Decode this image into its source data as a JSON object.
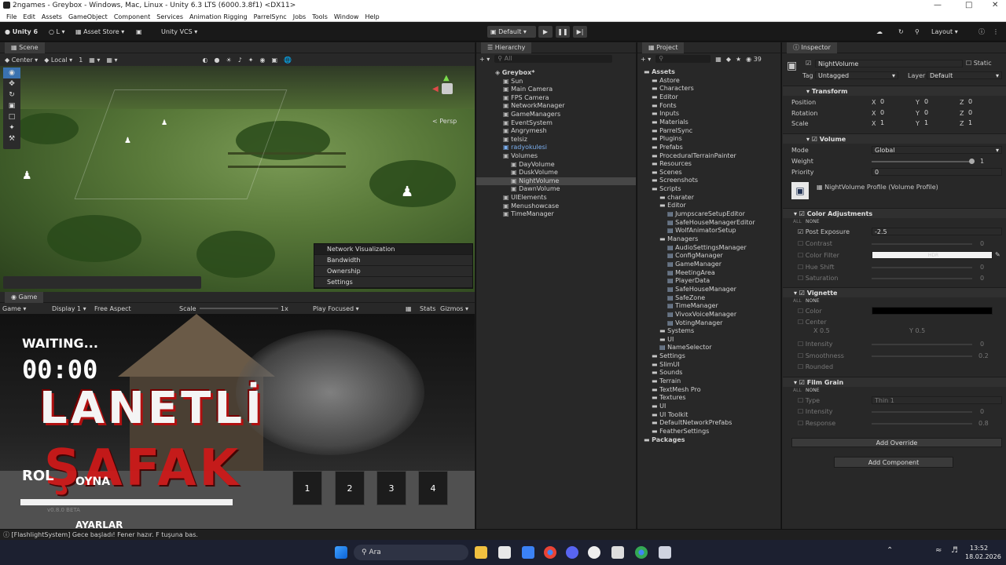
{
  "window": {
    "title": "2ngames - Greybox - Windows, Mac, Linux - Unity 6.3 LTS (6000.3.8f1) <DX11>"
  },
  "menu": [
    "File",
    "Edit",
    "Assets",
    "GameObject",
    "Component",
    "Services",
    "Animation Rigging",
    "ParrelSync",
    "Jobs",
    "Tools",
    "Window",
    "Help"
  ],
  "toolbar": {
    "account": "Unity 6",
    "user": "L",
    "asset_store": "Asset Store",
    "vcs": "Unity VCS",
    "play_mode": "Default",
    "layout": "Layout"
  },
  "scene": {
    "tab": "Scene",
    "pivot": "Center",
    "space": "Local",
    "grid": "1",
    "persp": "< Persp",
    "netvis": {
      "title": "Network Visualization",
      "items": [
        "Bandwidth",
        "Ownership",
        "Settings"
      ]
    }
  },
  "game": {
    "tab": "Game",
    "target": "Game",
    "display": "Display 1",
    "aspect": "Free Aspect",
    "scale_label": "Scale",
    "scale_value": "1x",
    "play_focused": "Play Focused",
    "stats": "Stats",
    "gizmos": "Gizmos",
    "waiting": "WAITING...",
    "timer": "00:00",
    "title1": "LANETLİ",
    "title2": "ŞAFAK",
    "menu_oyna": "OYNA",
    "menu_ayarlar": "AYARLAR",
    "menu_rol": "ROL",
    "slots": [
      "1",
      "2",
      "3",
      "4"
    ],
    "version": "v0.8.0 BETA"
  },
  "hierarchy": {
    "tab": "Hierarchy",
    "search": "All",
    "items": [
      {
        "label": "Greybox*",
        "depth": 0,
        "kind": "scene"
      },
      {
        "label": "Sun",
        "depth": 1
      },
      {
        "label": "Main Camera",
        "depth": 1
      },
      {
        "label": "FPS Camera",
        "depth": 1
      },
      {
        "label": "NetworkManager",
        "depth": 1
      },
      {
        "label": "GameManagers",
        "depth": 1
      },
      {
        "label": "EventSystem",
        "depth": 1
      },
      {
        "label": "Angrymesh",
        "depth": 1
      },
      {
        "label": "telsiz",
        "depth": 1
      },
      {
        "label": "radyokulesi",
        "depth": 1,
        "kind": "prefab"
      },
      {
        "label": "Volumes",
        "depth": 1
      },
      {
        "label": "DayVolume",
        "depth": 2
      },
      {
        "label": "DuskVolume",
        "depth": 2
      },
      {
        "label": "NightVolume",
        "depth": 2,
        "selected": true
      },
      {
        "label": "DawnVolume",
        "depth": 2
      },
      {
        "label": "UIElements",
        "depth": 1
      },
      {
        "label": "Menushowcase",
        "depth": 1
      },
      {
        "label": "TimeManager",
        "depth": 1
      }
    ]
  },
  "project": {
    "tab": "Project",
    "count": "39",
    "items": [
      {
        "label": "Assets",
        "depth": 0
      },
      {
        "label": "Astore",
        "depth": 1
      },
      {
        "label": "Characters",
        "depth": 1
      },
      {
        "label": "Editor",
        "depth": 1
      },
      {
        "label": "Fonts",
        "depth": 1
      },
      {
        "label": "Inputs",
        "depth": 1
      },
      {
        "label": "Materials",
        "depth": 1
      },
      {
        "label": "ParrelSync",
        "depth": 1
      },
      {
        "label": "Plugins",
        "depth": 1
      },
      {
        "label": "Prefabs",
        "depth": 1
      },
      {
        "label": "ProceduralTerrainPainter",
        "depth": 1
      },
      {
        "label": "Resources",
        "depth": 1
      },
      {
        "label": "Scenes",
        "depth": 1
      },
      {
        "label": "Screenshots",
        "depth": 1
      },
      {
        "label": "Scripts",
        "depth": 1
      },
      {
        "label": "charater",
        "depth": 2
      },
      {
        "label": "Editor",
        "depth": 2
      },
      {
        "label": "JumpscareSetupEditor",
        "depth": 3
      },
      {
        "label": "SafeHouseManagerEditor",
        "depth": 3
      },
      {
        "label": "WolfAnimatorSetup",
        "depth": 3
      },
      {
        "label": "Managers",
        "depth": 2
      },
      {
        "label": "AudioSettingsManager",
        "depth": 3
      },
      {
        "label": "ConfigManager",
        "depth": 3
      },
      {
        "label": "GameManager",
        "depth": 3
      },
      {
        "label": "MeetingArea",
        "depth": 3
      },
      {
        "label": "PlayerData",
        "depth": 3
      },
      {
        "label": "SafeHouseManager",
        "depth": 3
      },
      {
        "label": "SafeZone",
        "depth": 3
      },
      {
        "label": "TimeManager",
        "depth": 3
      },
      {
        "label": "VivoxVoiceManager",
        "depth": 3
      },
      {
        "label": "VotingManager",
        "depth": 3
      },
      {
        "label": "Systems",
        "depth": 2
      },
      {
        "label": "UI",
        "depth": 2
      },
      {
        "label": "NameSelector",
        "depth": 2
      },
      {
        "label": "Settings",
        "depth": 1
      },
      {
        "label": "SlimUI",
        "depth": 1
      },
      {
        "label": "Sounds",
        "depth": 1
      },
      {
        "label": "Terrain",
        "depth": 1
      },
      {
        "label": "TextMesh Pro",
        "depth": 1
      },
      {
        "label": "Textures",
        "depth": 1
      },
      {
        "label": "UI",
        "depth": 1
      },
      {
        "label": "UI Toolkit",
        "depth": 1
      },
      {
        "label": "DefaultNetworkPrefabs",
        "depth": 1
      },
      {
        "label": "FeatherSettings",
        "depth": 1
      },
      {
        "label": "Packages",
        "depth": 0
      }
    ]
  },
  "inspector": {
    "tab": "Inspector",
    "object_name": "NightVolume",
    "static": "Static",
    "tag_label": "Tag",
    "tag": "Untagged",
    "layer_label": "Layer",
    "layer": "Default",
    "transform": {
      "title": "Transform",
      "position": "Position",
      "rotation": "Rotation",
      "scale": "Scale",
      "x": "X",
      "y": "Y",
      "z": "Z",
      "pos": [
        "0",
        "0",
        "0"
      ],
      "rot": [
        "0",
        "0",
        "0"
      ],
      "scl": [
        "1",
        "1",
        "1"
      ]
    },
    "volume": {
      "title": "Volume",
      "mode_label": "Mode",
      "mode": "Global",
      "weight_label": "Weight",
      "weight": "1",
      "priority_label": "Priority",
      "priority": "0",
      "profile": "NightVolume Profile (Volume Profile)"
    },
    "color_adj": {
      "title": "Color Adjustments",
      "all": "ALL",
      "none": "NONE",
      "post_exposure": "Post Exposure",
      "post_exposure_value": "-2.5",
      "contrast": "Contrast",
      "contrast_value": "0",
      "color_filter": "Color Filter",
      "color_filter_value": "HDR",
      "hue_shift": "Hue Shift",
      "hue_value": "0",
      "saturation": "Saturation",
      "saturation_value": "0"
    },
    "vignette": {
      "title": "Vignette",
      "all": "ALL",
      "none": "NONE",
      "color": "Color",
      "center": "Center",
      "cx": "0.5",
      "cy": "0.5",
      "intensity": "Intensity",
      "intensity_value": "0",
      "smoothness": "Smoothness",
      "smoothness_value": "0.2",
      "rounded": "Rounded"
    },
    "film_grain": {
      "title": "Film Grain",
      "all": "ALL",
      "none": "NONE",
      "type": "Type",
      "type_value": "Thin 1",
      "intensity": "Intensity",
      "intensity_value": "0",
      "response": "Response",
      "response_value": "0.8"
    },
    "add_override": "Add Override",
    "add_component": "Add Component"
  },
  "status": {
    "message": "[FlashlightSystem] Gece başladı! Fener hazır. F tuşuna bas."
  },
  "taskbar": {
    "search": "Ara",
    "time": "13:52",
    "date": "18.02.2026"
  }
}
